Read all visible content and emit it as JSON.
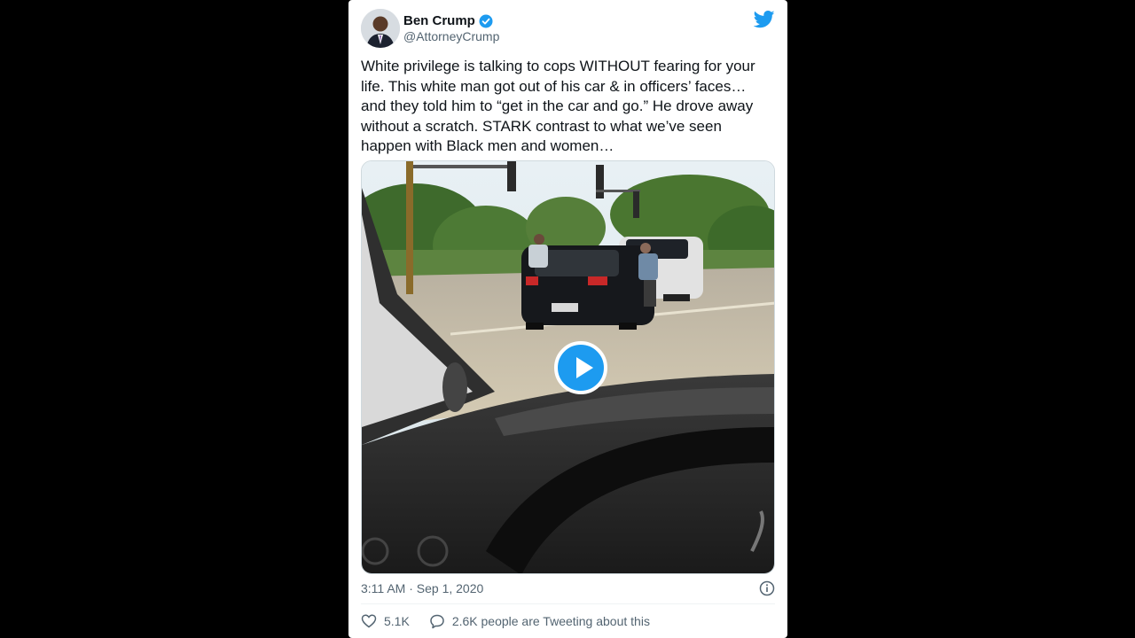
{
  "tweet": {
    "author_name": "Ben Crump",
    "author_handle": "@AttorneyCrump",
    "text": "White privilege is talking to cops WITHOUT fearing for your life. This white man got out of his car & in officers’ faces… and they told him to “get in the car and go.” He drove away without a scratch. STARK contrast to what we’ve seen happen with Black men and women…",
    "timestamp": "3:11 AM · Sep 1, 2020",
    "likes": "5.1K",
    "retweets_text": "2.6K people are Tweeting about this"
  },
  "icons": {
    "verified": "verified-badge-icon",
    "brand": "twitter-bird-icon",
    "play": "play-icon",
    "info": "info-icon",
    "like": "heart-icon",
    "reply": "speech-bubble-icon"
  },
  "colors": {
    "accent": "#1d9bf0",
    "text": "#0f1419",
    "secondary": "#536471"
  }
}
